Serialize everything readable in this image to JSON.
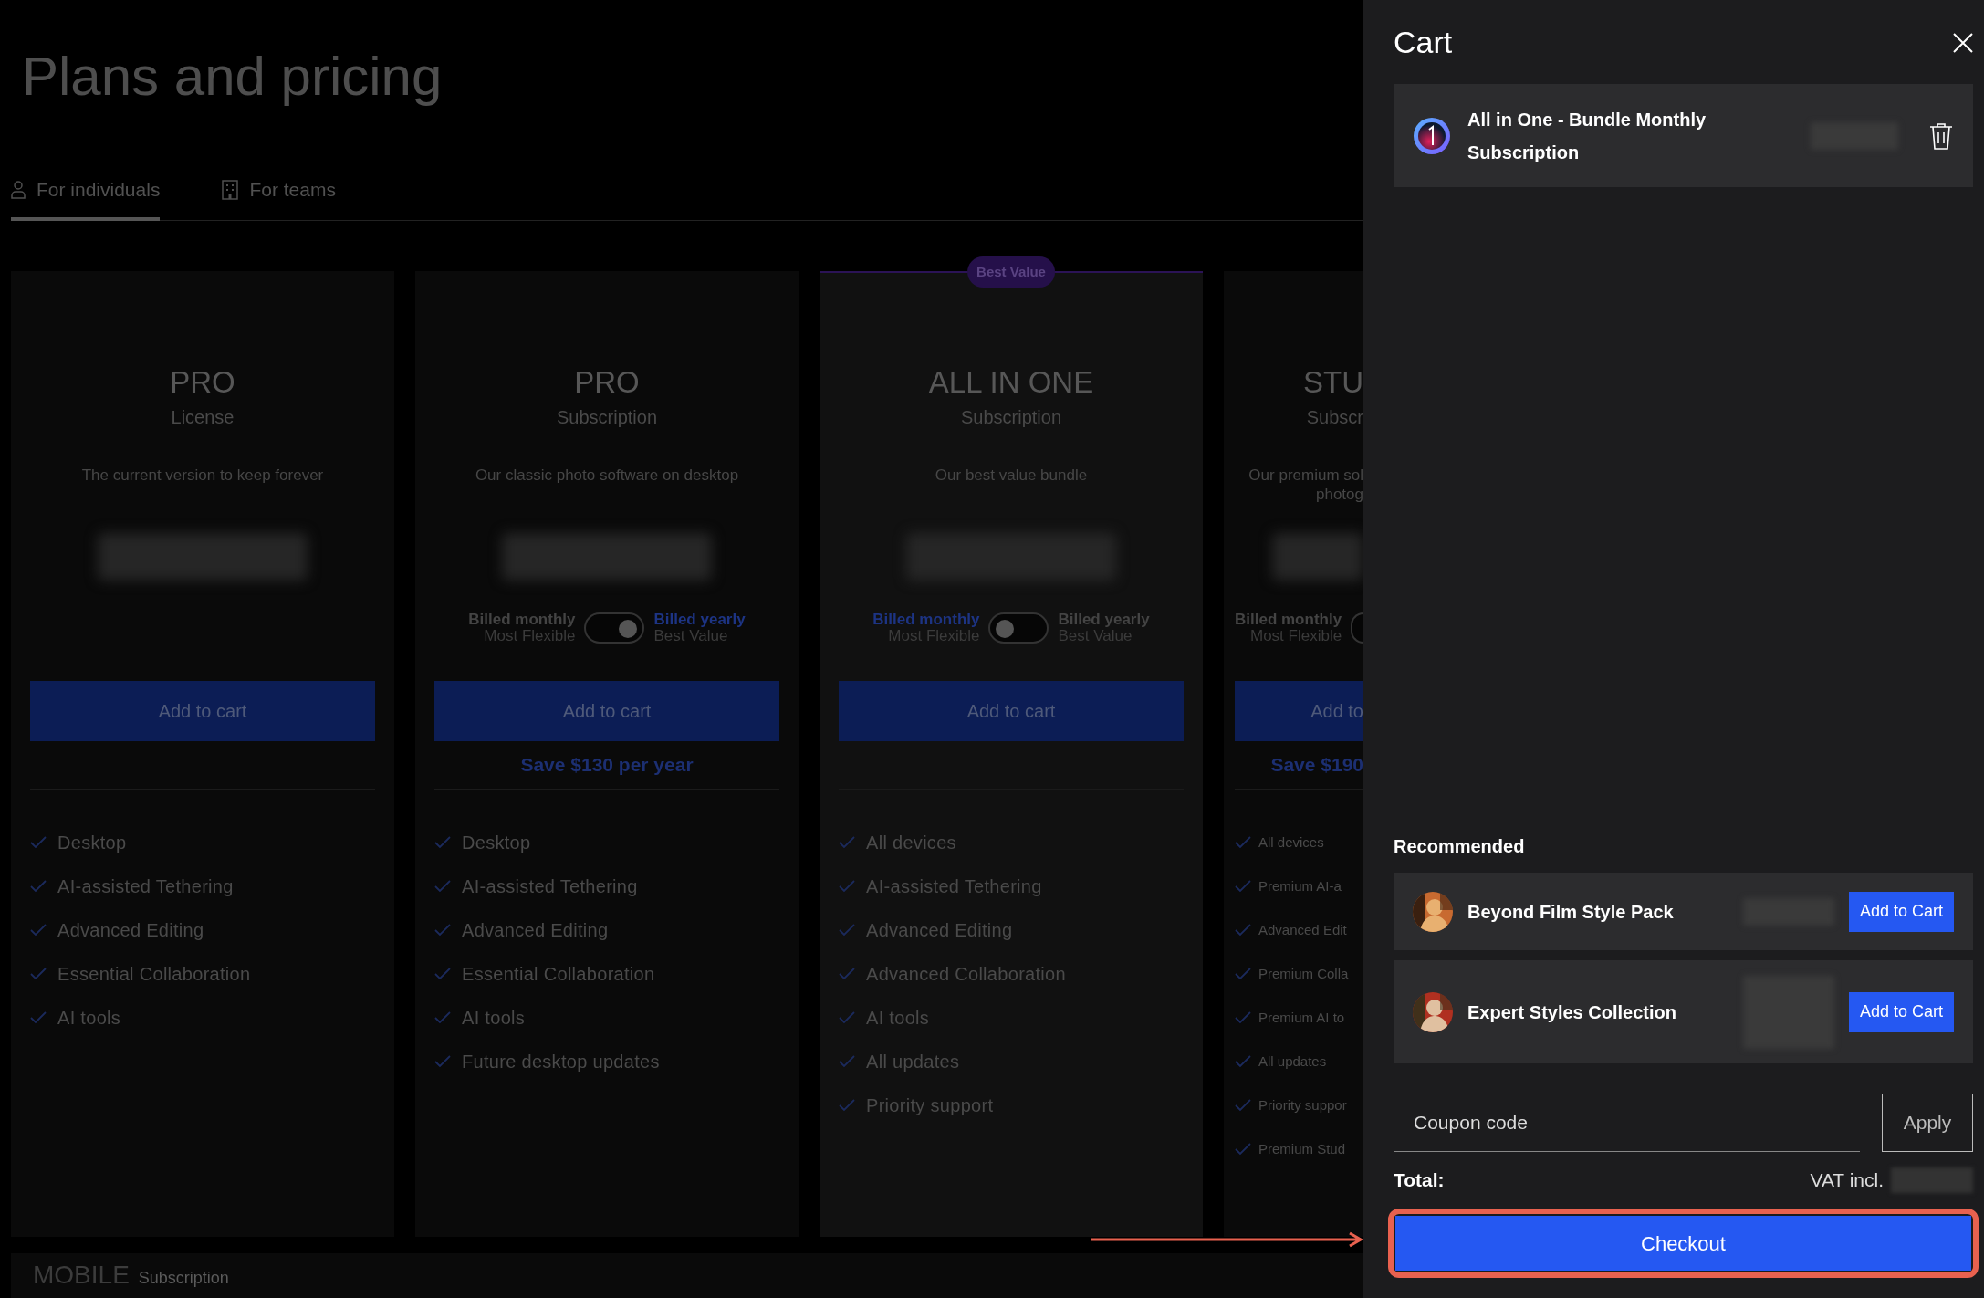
{
  "page": {
    "title": "Plans and pricing",
    "tabs": [
      {
        "label": "For individuals",
        "kind": "person",
        "selected": true
      },
      {
        "label": "For teams",
        "kind": "building",
        "selected": false
      }
    ]
  },
  "plans": [
    {
      "title": "PRO",
      "subtitle": "License",
      "description": "The current version to keep forever",
      "button": "Add to cart",
      "features": [
        "Desktop",
        "AI-assisted Tethering",
        "Advanced Editing",
        "Essential Collaboration",
        "AI tools"
      ]
    },
    {
      "title": "PRO",
      "subtitle": "Subscription",
      "description": "Our classic photo software on desktop",
      "billing": [
        {
          "label": "Billed monthly",
          "note": "Most Flexible",
          "selected": false
        },
        {
          "label": "Billed yearly",
          "note": "Best Value",
          "selected": true
        }
      ],
      "button": "Add to cart",
      "savings": "Save $130 per year",
      "features": [
        "Desktop",
        "AI-assisted Tethering",
        "Advanced Editing",
        "Essential Collaboration",
        "AI tools",
        "Future desktop updates"
      ]
    },
    {
      "title": "ALL IN ONE",
      "subtitle": "Subscription",
      "description": "Our best value bundle",
      "badge": "Best Value",
      "highlighted": true,
      "billing": [
        {
          "label": "Billed monthly",
          "note": "Most Flexible",
          "selected": true
        },
        {
          "label": "Billed yearly",
          "note": "Best Value",
          "selected": false
        }
      ],
      "button": "Add to cart",
      "features": [
        "All devices",
        "AI-assisted Tethering",
        "Advanced Editing",
        "Advanced Collaboration",
        "AI tools",
        "All updates",
        "Priority support"
      ]
    },
    {
      "title": "STU",
      "subtitle": "Subscr",
      "description": "Our premium sol\nphotog",
      "cut": true,
      "billing": [
        {
          "label": "Billed monthly",
          "note": "Most Flexible",
          "selected": false
        }
      ],
      "button": "Add to",
      "savings": "Save $190",
      "features": [
        "All devices",
        "Premium AI-a",
        "Advanced Edit",
        "Premium Colla",
        "Premium AI to",
        "All updates",
        "Priority suppor",
        "Premium Stud"
      ]
    }
  ],
  "mobile": {
    "title": "MOBILE",
    "subtitle": "Subscription"
  },
  "cart": {
    "title": "Cart",
    "items": [
      {
        "name": "All in One - Bundle Monthly Subscription"
      }
    ],
    "recommended": {
      "title": "Recommended",
      "items": [
        {
          "name": "Beyond Film Style Pack",
          "button": "Add to Cart"
        },
        {
          "name": "Expert Styles Collection",
          "button": "Add to Cart"
        }
      ]
    },
    "coupon": {
      "placeholder": "Coupon code",
      "button": "Apply"
    },
    "total": {
      "label": "Total:",
      "vat": "VAT incl."
    },
    "checkout": {
      "label": "Checkout",
      "highlighted": true
    }
  }
}
